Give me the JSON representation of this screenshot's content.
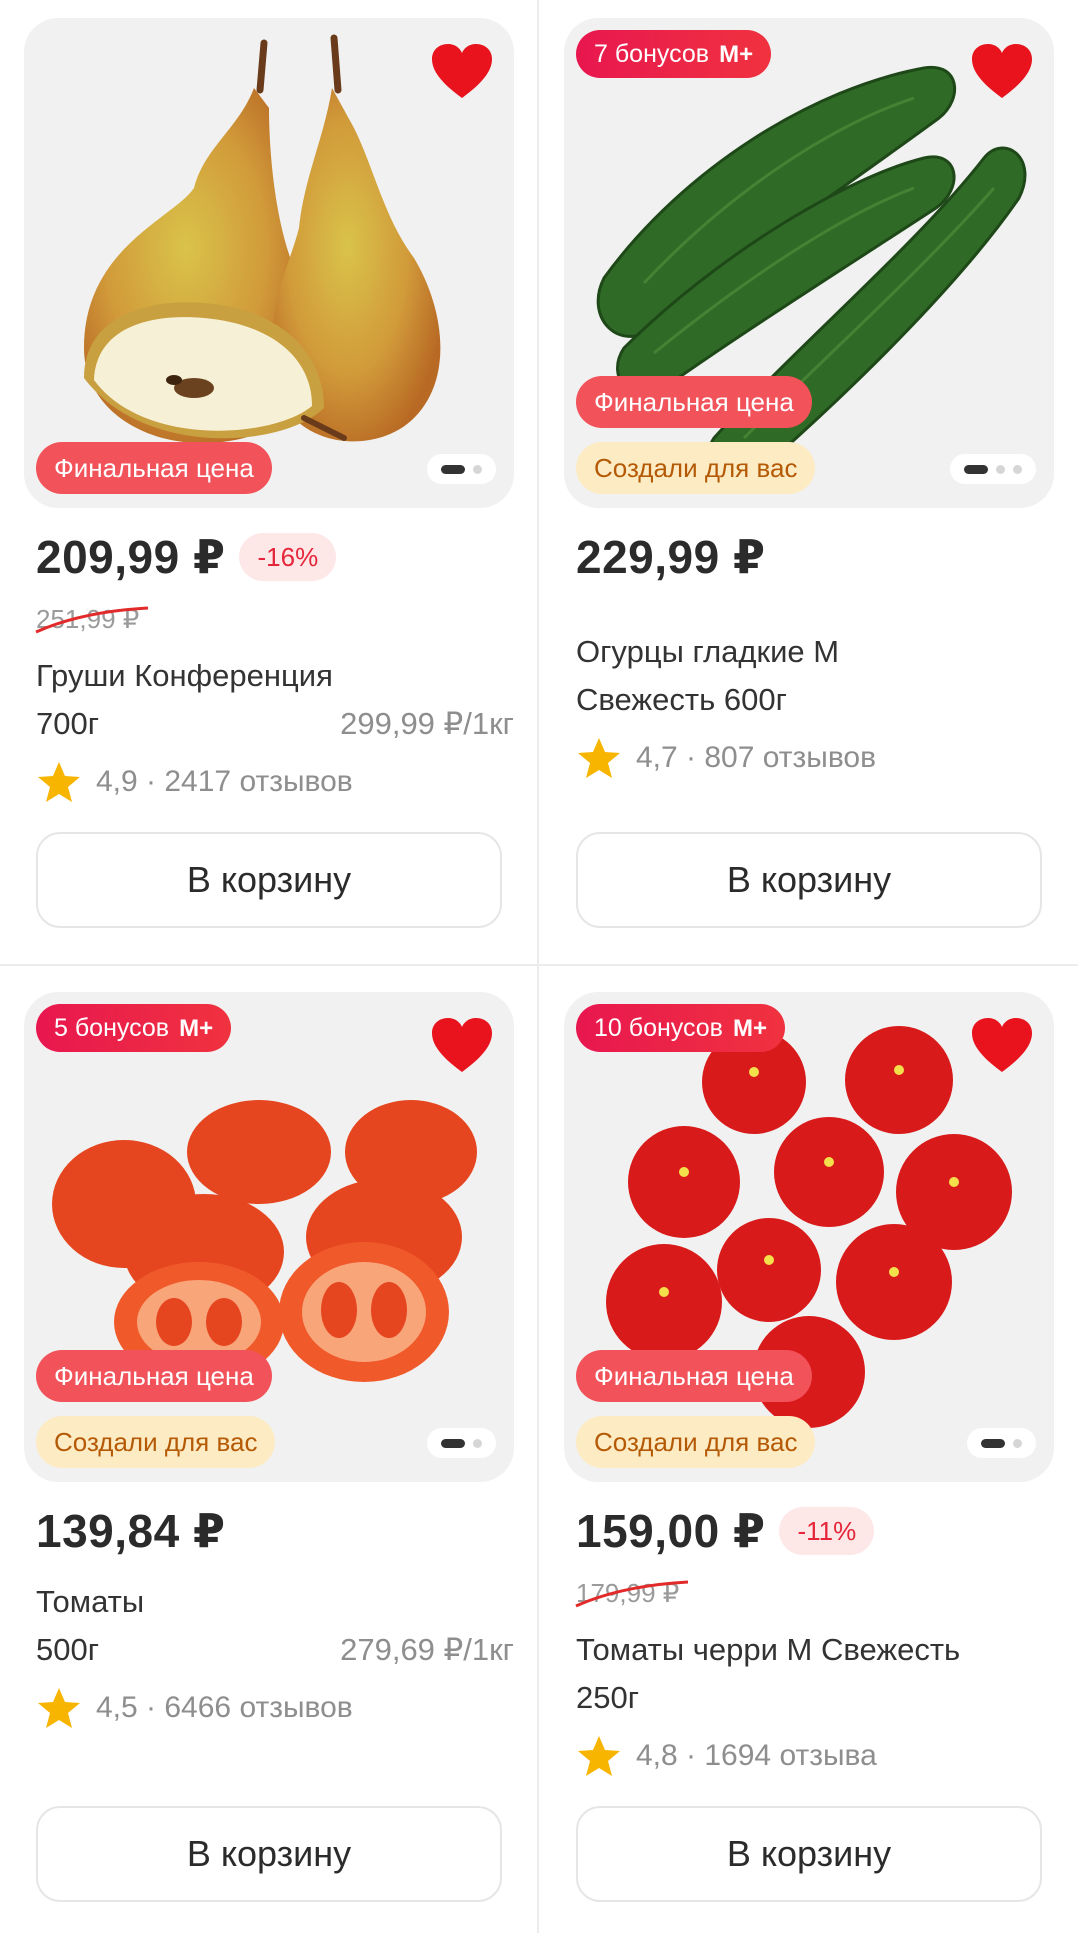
{
  "products": [
    {
      "bonus": "",
      "tag_final": "Финальная цена",
      "tag_made": "",
      "price": "209,99 ₽",
      "discount": "-16%",
      "old_price": "251,99 ₽",
      "title_line1": "Груши Конференция",
      "title_line2": "700г",
      "unit_price": "299,99 ₽/1кг",
      "rating": "4,9 · 2417 отзывов",
      "cart_label": "В корзину",
      "image_icon": "pear-image"
    },
    {
      "bonus": "7 бонусов",
      "tag_final": "Финальная цена",
      "tag_made": "Создали для вас",
      "price": "229,99 ₽",
      "discount": "",
      "old_price": "",
      "title_line1": "Огурцы гладкие М",
      "title_line2": "Свежесть 600г",
      "unit_price": "",
      "rating": "4,7 · 807 отзывов",
      "cart_label": "В корзину",
      "image_icon": "cucumber-image"
    },
    {
      "bonus": "5 бонусов",
      "tag_final": "Финальная цена",
      "tag_made": "Создали для вас",
      "price": "139,84 ₽",
      "discount": "",
      "old_price": "",
      "title_line1": "Томаты",
      "title_line2": "500г",
      "unit_price": "279,69 ₽/1кг",
      "rating": "4,5 · 6466 отзывов",
      "cart_label": "В корзину",
      "image_icon": "tomato-image"
    },
    {
      "bonus": "10 бонусов",
      "tag_final": "Финальная цена",
      "tag_made": "Создали для вас",
      "price": "159,00 ₽",
      "discount": "-11%",
      "old_price": "179,99 ₽",
      "title_line1": "Томаты черри М Свежесть",
      "title_line2": "250г",
      "unit_price": "",
      "rating": "4,8 · 1694 отзыва",
      "cart_label": "В корзину",
      "image_icon": "cherry-tomato-image"
    }
  ],
  "bonus_brand": "М+",
  "colors": {
    "accent_red": "#f2525a",
    "bonus_red": "#e8174f",
    "heart": "#e8131c",
    "discount_text": "#e5263a",
    "made_for_you_bg": "#fdebc4",
    "star": "#f7b500"
  }
}
